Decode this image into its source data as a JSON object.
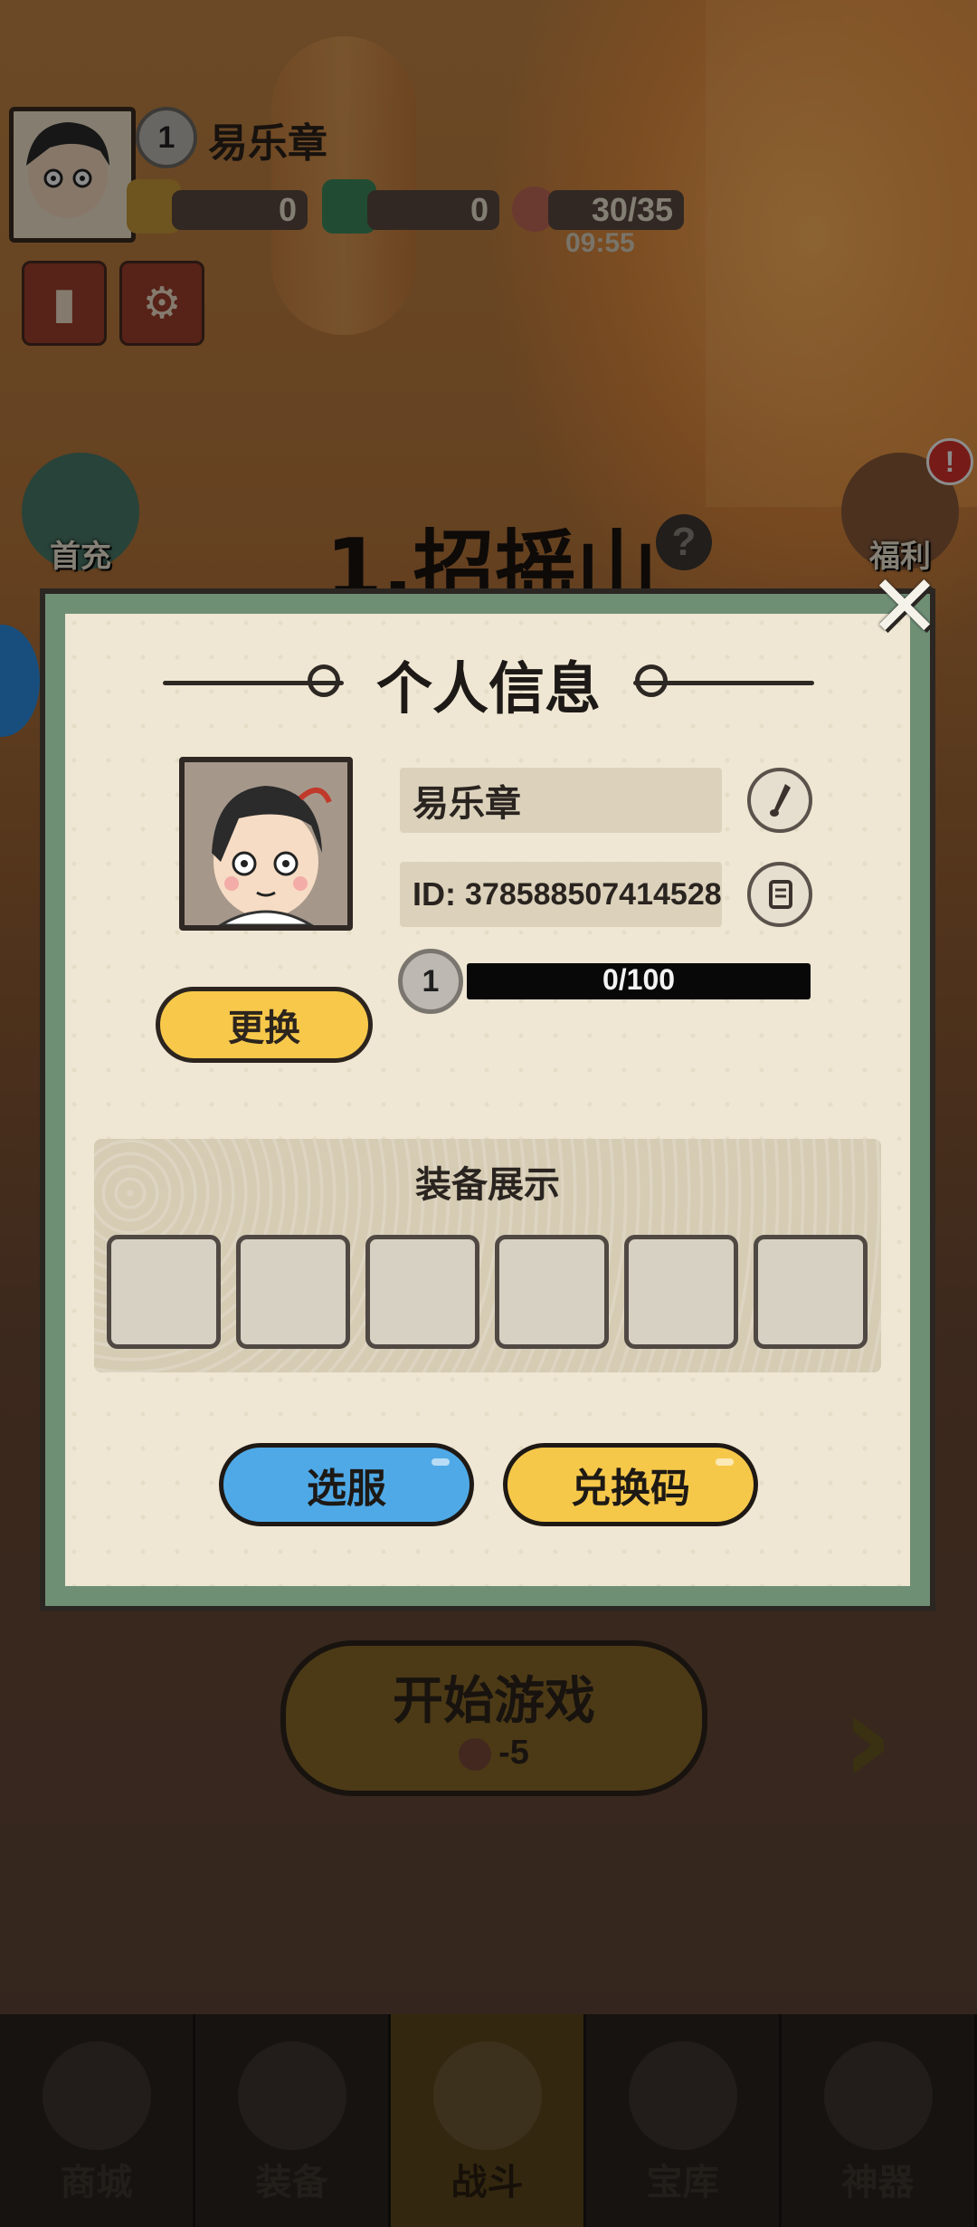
{
  "hud": {
    "player_level": "1",
    "player_name": "易乐章",
    "resources": [
      {
        "icon": "gold-ingot-icon",
        "value": "0"
      },
      {
        "icon": "jade-dragon-icon",
        "value": "0"
      },
      {
        "icon": "peach-stamina-icon",
        "value": "30/35"
      }
    ],
    "stamina_timer": "09:55",
    "first_recharge_label": "首充",
    "welfare_label": "福利",
    "welfare_alert": "!"
  },
  "stage": {
    "title": "1.招摇山",
    "help": "?",
    "start_label": "开始游戏",
    "start_cost": "-5"
  },
  "modal": {
    "title": "个人信息",
    "name": "易乐章",
    "id_prefix": "ID:",
    "id_value": "378588507414528",
    "level": "1",
    "xp_text": "0/100",
    "xp_fraction": 0,
    "change_button": "更换",
    "equipment_title": "装备展示",
    "equipment_slots": 6,
    "server_button": "选服",
    "redeem_button": "兑换码",
    "close_icon": "close-icon"
  },
  "nav": [
    {
      "label": "商城",
      "icon": "shop-icon",
      "active": false
    },
    {
      "label": "装备",
      "icon": "helmet-icon",
      "active": false
    },
    {
      "label": "战斗",
      "icon": "crossed-swords-icon",
      "active": true
    },
    {
      "label": "宝库",
      "icon": "mountain-icon",
      "active": false
    },
    {
      "label": "神器",
      "icon": "orb-icon",
      "active": false
    }
  ]
}
